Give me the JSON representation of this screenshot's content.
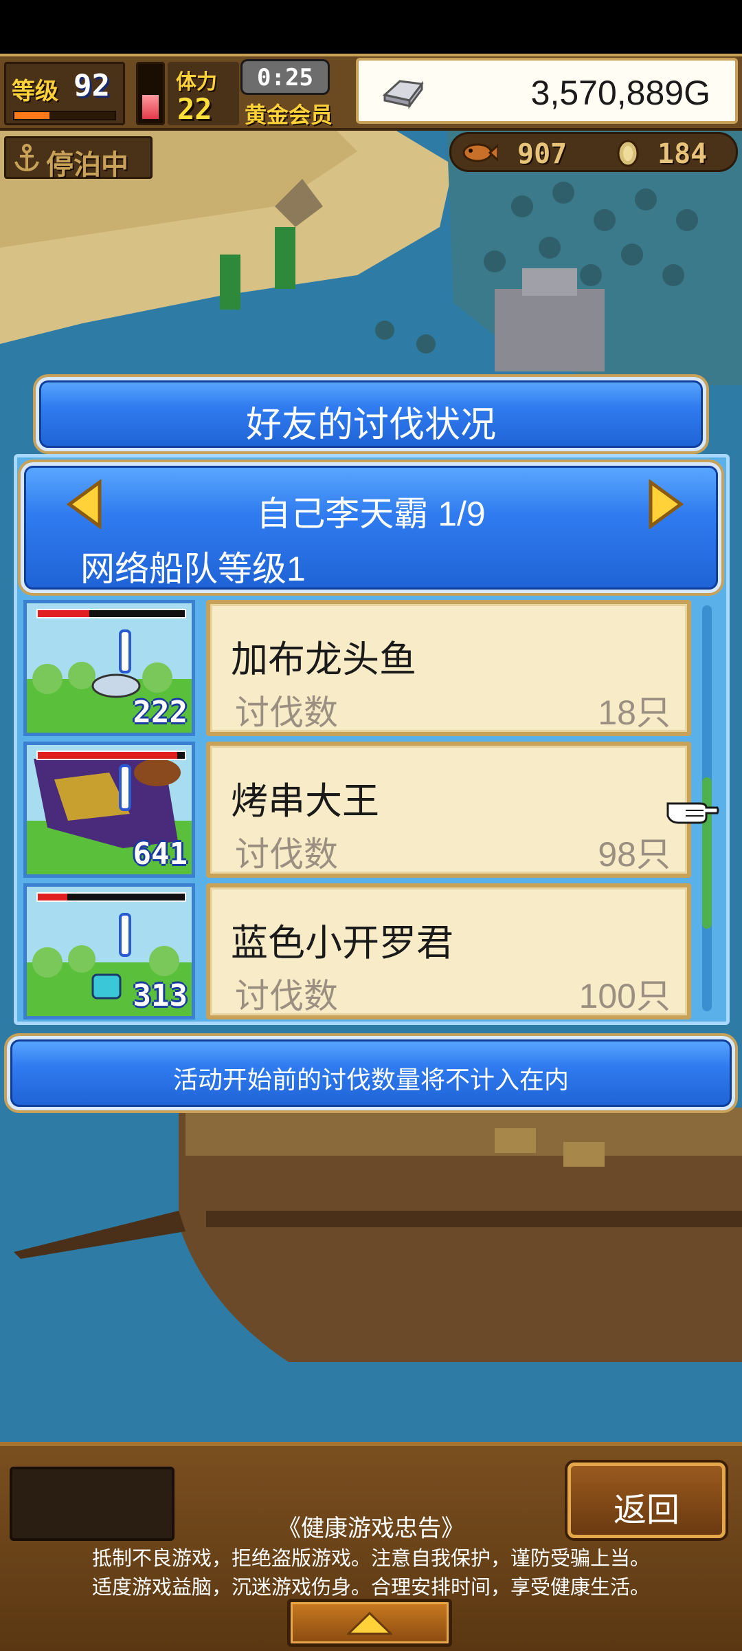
{
  "hud": {
    "level_label": "等级",
    "level_value": "92",
    "level_exp_fraction": 0.35,
    "stamina_gauge_fraction": 0.45,
    "stamina_label": "体力",
    "stamina_value": "22",
    "timer": "0:25",
    "membership": "黄金会员",
    "gold": "3,570,889G",
    "anchor_status": "停泊中",
    "fish_count": "907",
    "coin_count": "184"
  },
  "dialog": {
    "title": "好友的讨伐状况",
    "friend_name": "自己李天霸 1/9",
    "fleet_level": "网络船队等级1",
    "monsters": [
      {
        "name": "加布龙头鱼",
        "kills_label": "讨伐数",
        "kills": "18只",
        "thumb_count": "222",
        "hp_fraction": 0.35
      },
      {
        "name": "烤串大王",
        "kills_label": "讨伐数",
        "kills": "98只",
        "thumb_count": "641",
        "hp_fraction": 0.95
      },
      {
        "name": "蓝色小开罗君",
        "kills_label": "讨伐数",
        "kills": "100只",
        "thumb_count": "313",
        "hp_fraction": 0.2
      }
    ],
    "notice": "活动开始前的讨伐数量将不计入在内"
  },
  "bottom": {
    "back_label": "返回",
    "health_title": "《健康游戏忠告》",
    "health_line_1": "抵制不良游戏，拒绝盗版游戏。注意自我保护，谨防受骗上当。",
    "health_line_2": "适度游戏益脑，沉迷游戏伤身。合理安排时间，享受健康生活。"
  },
  "colors": {
    "panel_blue": "#2f7bef",
    "card_bg": "#f8ebc8",
    "gold_trim": "#c9a25a",
    "wood": "#6b4a22"
  }
}
